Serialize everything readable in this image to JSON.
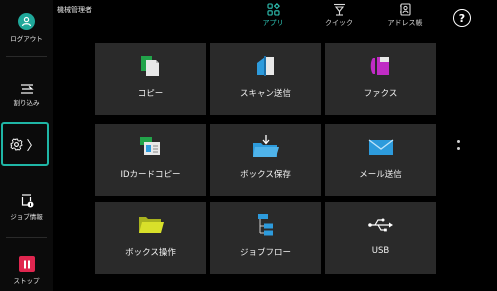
{
  "header": {
    "user_name": "機械管理者",
    "tabs": [
      {
        "label": "アプリ",
        "active": true
      },
      {
        "label": "クイック",
        "active": false
      },
      {
        "label": "アドレス帳",
        "active": false
      }
    ],
    "help_glyph": "?"
  },
  "sidebar": {
    "logout_label": "ログアウト",
    "interrupt_label": "割り込み",
    "settings_chevron": "〉",
    "job_status_label": "ジョブ情報",
    "stop_label": "ストップ"
  },
  "apps": [
    {
      "label": "コピー",
      "icon": "copy-icon"
    },
    {
      "label": "スキャン送信",
      "icon": "scan-icon"
    },
    {
      "label": "ファクス",
      "icon": "fax-icon"
    },
    {
      "label": "IDカードコピー",
      "icon": "id-card-icon"
    },
    {
      "label": "ボックス保存",
      "icon": "box-save-icon"
    },
    {
      "label": "メール送信",
      "icon": "mail-icon"
    },
    {
      "label": "ボックス操作",
      "icon": "box-operation-icon"
    },
    {
      "label": "ジョブフロー",
      "icon": "job-flow-icon"
    },
    {
      "label": "USB",
      "icon": "usb-icon"
    }
  ],
  "colors": {
    "accent": "#2fc7b8",
    "logout": "#1fa89a",
    "stop": "#e0264f",
    "copy_green": "#22a34a",
    "scan_blue": "#2d9bdc",
    "fax_magenta": "#c02cc4",
    "folder_yellow": "#d8e02a"
  }
}
